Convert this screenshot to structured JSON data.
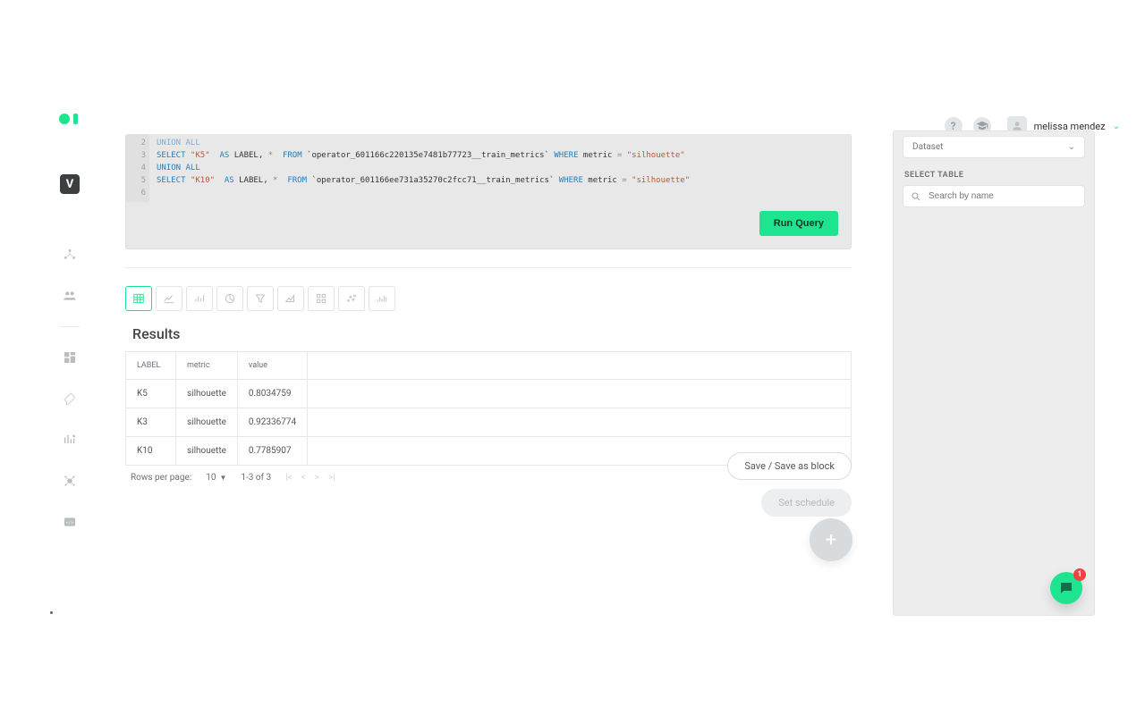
{
  "header": {
    "user": "melissa mendez"
  },
  "rail": {
    "v_label": "V"
  },
  "code": {
    "gutter": [
      "2",
      "3",
      "4",
      "5",
      "6"
    ],
    "lines": [
      {
        "text": "UNION ALL",
        "cls": "kw dim"
      },
      {
        "tokens": [
          {
            "t": "SELECT ",
            "c": "kw"
          },
          {
            "t": "\"K5\"",
            "c": "str"
          },
          {
            "t": "  ",
            "c": ""
          },
          {
            "t": "AS",
            "c": "kw"
          },
          {
            "t": " LABEL, ",
            "c": ""
          },
          {
            "t": "*",
            "c": "op"
          },
          {
            "t": "  ",
            "c": ""
          },
          {
            "t": "FROM",
            "c": "kw"
          },
          {
            "t": " `operator_601166c220135e7481b77723__train_metrics` ",
            "c": ""
          },
          {
            "t": "WHERE",
            "c": "kw"
          },
          {
            "t": " metric ",
            "c": ""
          },
          {
            "t": "=",
            "c": "op"
          },
          {
            "t": " ",
            "c": ""
          },
          {
            "t": "\"silhouette\"",
            "c": "str"
          }
        ]
      },
      {
        "tokens": [
          {
            "t": "UNION ALL",
            "c": "kw"
          }
        ]
      },
      {
        "tokens": [
          {
            "t": "SELECT ",
            "c": "kw"
          },
          {
            "t": "\"K10\"",
            "c": "str"
          },
          {
            "t": "  ",
            "c": ""
          },
          {
            "t": "AS",
            "c": "kw"
          },
          {
            "t": " LABEL, ",
            "c": ""
          },
          {
            "t": "*",
            "c": "op"
          },
          {
            "t": "  ",
            "c": ""
          },
          {
            "t": "FROM",
            "c": "kw"
          },
          {
            "t": " `operator_601166ee731a35270c2fcc71__train_metrics` ",
            "c": ""
          },
          {
            "t": "WHERE",
            "c": "kw"
          },
          {
            "t": " metric ",
            "c": ""
          },
          {
            "t": "=",
            "c": "op"
          },
          {
            "t": " ",
            "c": ""
          },
          {
            "t": "\"silhouette\"",
            "c": "str"
          }
        ]
      },
      {
        "tokens": [
          {
            "t": "",
            "c": ""
          }
        ]
      }
    ],
    "run_label": "Run Query"
  },
  "results": {
    "title": "Results",
    "headers": [
      "LABEL",
      "metric",
      "value"
    ],
    "rows": [
      {
        "label": "K5",
        "metric": "silhouette",
        "value": "0.8034759"
      },
      {
        "label": "K3",
        "metric": "silhouette",
        "value": "0.92336774"
      },
      {
        "label": "K10",
        "metric": "silhouette",
        "value": "0.7785907"
      }
    ],
    "pager": {
      "rpp_label": "Rows per page:",
      "rpp_value": "10",
      "range": "1-3 of 3"
    }
  },
  "actions": {
    "save": "Save / Save as block",
    "schedule": "Set schedule"
  },
  "side": {
    "dataset_label": "Dataset",
    "select_table": "SELECT TABLE",
    "search_placeholder": "Search by name"
  },
  "chat": {
    "badge": "1"
  }
}
